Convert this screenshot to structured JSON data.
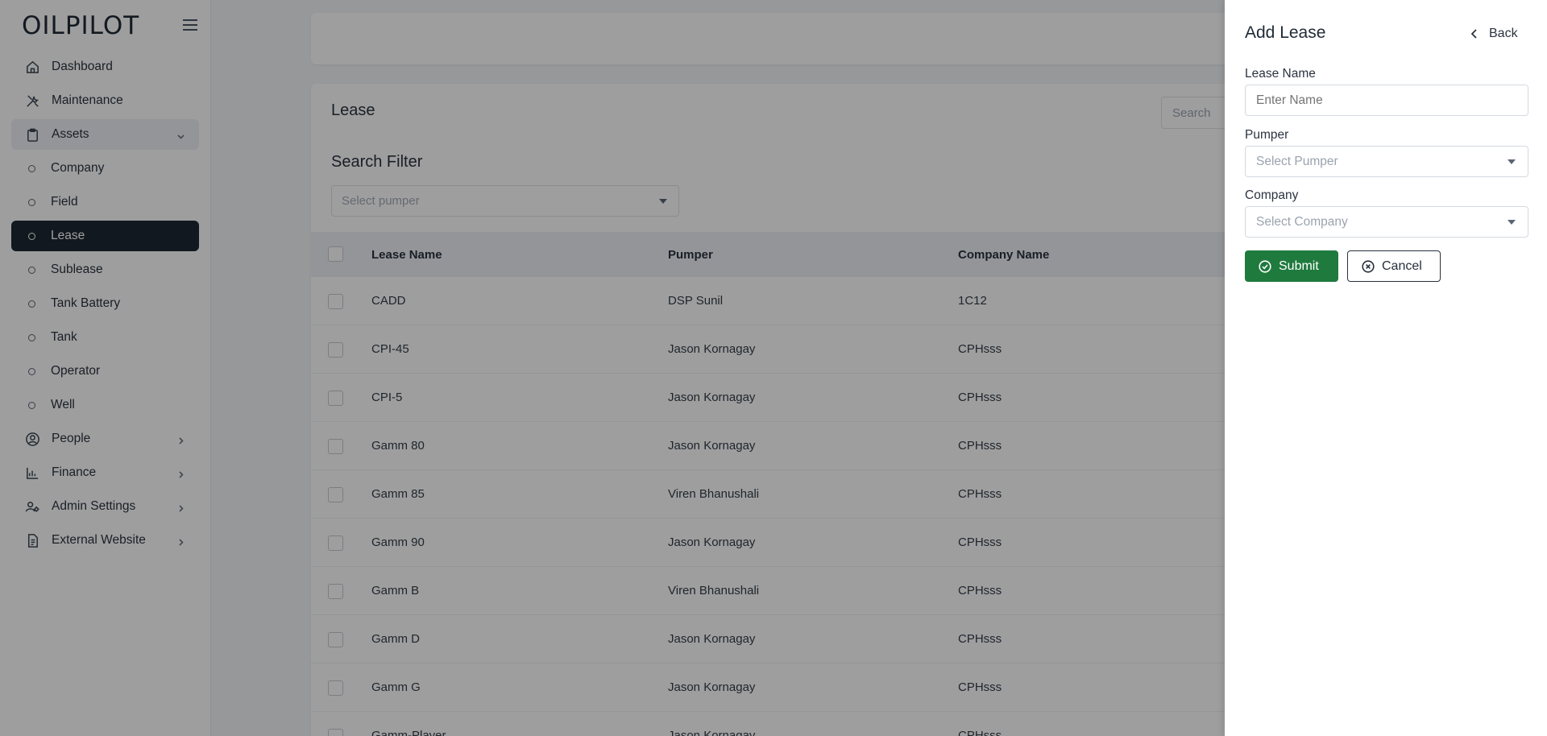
{
  "app": {
    "logo": "OILPILOT"
  },
  "sidebar": {
    "items": [
      {
        "label": "Dashboard",
        "icon": "home-icon"
      },
      {
        "label": "Maintenance",
        "icon": "tools-icon"
      },
      {
        "label": "Assets",
        "icon": "clipboard-icon",
        "expanded": true
      },
      {
        "label": "Company",
        "sub": true
      },
      {
        "label": "Field",
        "sub": true
      },
      {
        "label": "Lease",
        "sub": true,
        "active": true
      },
      {
        "label": "Sublease",
        "sub": true
      },
      {
        "label": "Tank Battery",
        "sub": true
      },
      {
        "label": "Tank",
        "sub": true
      },
      {
        "label": "Operator",
        "sub": true
      },
      {
        "label": "Well",
        "sub": true
      },
      {
        "label": "People",
        "icon": "user-circle-icon"
      },
      {
        "label": "Finance",
        "icon": "chart-icon"
      },
      {
        "label": "Admin Settings",
        "icon": "users-cog-icon"
      },
      {
        "label": "External Website",
        "icon": "document-icon"
      }
    ]
  },
  "main": {
    "title": "Lease",
    "search_placeholder": "Search",
    "filter_title": "Search Filter",
    "pumper_filter_placeholder": "Select pumper",
    "table": {
      "headers": [
        "Lease Name",
        "Pumper",
        "Company Name"
      ],
      "rows": [
        [
          "CADD",
          "DSP Sunil",
          "1C12"
        ],
        [
          "CPI-45",
          "Jason Kornagay",
          "CPHsss"
        ],
        [
          "CPI-5",
          "Jason Kornagay",
          "CPHsss"
        ],
        [
          "Gamm 80",
          "Jason Kornagay",
          "CPHsss"
        ],
        [
          "Gamm 85",
          "Viren Bhanushali",
          "CPHsss"
        ],
        [
          "Gamm 90",
          "Jason Kornagay",
          "CPHsss"
        ],
        [
          "Gamm B",
          "Viren Bhanushali",
          "CPHsss"
        ],
        [
          "Gamm D",
          "Jason Kornagay",
          "CPHsss"
        ],
        [
          "Gamm G",
          "Jason Kornagay",
          "CPHsss"
        ],
        [
          "Gamm-Player",
          "Jason Kornagay",
          "CPHsss"
        ]
      ]
    }
  },
  "drawer": {
    "title": "Add Lease",
    "back_label": "Back",
    "lease_name_label": "Lease Name",
    "lease_name_placeholder": "Enter Name",
    "lease_name_value": "",
    "pumper_label": "Pumper",
    "pumper_placeholder": "Select Pumper",
    "company_label": "Company",
    "company_placeholder": "Select Company",
    "submit_label": "Submit",
    "cancel_label": "Cancel"
  },
  "colors": {
    "accent_dark": "#1c2733",
    "submit_green": "#1f7a3e",
    "overlay": "rgba(0,0,0,0.38)"
  }
}
